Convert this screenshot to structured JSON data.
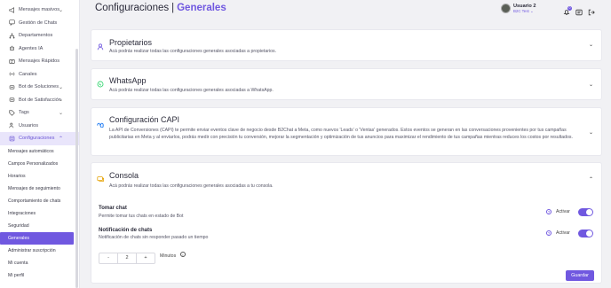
{
  "sidebar": {
    "items": [
      {
        "label": "Mensajes masivos",
        "icon": "megaphone-icon",
        "chevron": true
      },
      {
        "label": "Gestión de Chats",
        "icon": "chat-icon",
        "chevron": false
      },
      {
        "label": "Departamentos",
        "icon": "sitemap-icon",
        "chevron": false
      },
      {
        "label": "Agentes IA",
        "icon": "robot-icon",
        "chevron": false
      },
      {
        "label": "Mensajes Rápidos",
        "icon": "message-icon",
        "chevron": false
      },
      {
        "label": "Canales",
        "icon": "broadcast-icon",
        "chevron": false
      },
      {
        "label": "Bot de Soluciones",
        "icon": "bot-icon",
        "chevron": true
      },
      {
        "label": "Bot de Satisfacción",
        "icon": "bot-icon",
        "chevron": true
      },
      {
        "label": "Tags",
        "icon": "tag-icon",
        "chevron": true
      },
      {
        "label": "Usuarios",
        "icon": "users-icon",
        "chevron": false
      },
      {
        "label": "Configuraciones",
        "icon": "settings-icon",
        "chevron": true
      }
    ],
    "sub_items": [
      "Mensajes automáticos",
      "Campos Personalizados",
      "Horarios",
      "Mensajes de seguimiento",
      "Comportamiento de chats",
      "Integraciones",
      "Seguridad",
      "Generales",
      "Administrar suscripción",
      "Mi cuenta",
      "Mi perfil"
    ],
    "active_sub": "Generales"
  },
  "header": {
    "title": "Configuraciones",
    "separator": "|",
    "subtitle": "Generales",
    "user_name": "Usuario 2",
    "user_org": "B2C Test",
    "notif_count": "0"
  },
  "cards": {
    "propietarios": {
      "title": "Propietarios",
      "desc": "Acá podrás realizar todas las configuraciones generales asociadas a propietarios."
    },
    "whatsapp": {
      "title": "WhatsApp",
      "desc": "Acá podrás realizar todas las configuraciones generales asociadas a WhatsApp."
    },
    "capi": {
      "title": "Configuración CAPI",
      "desc": "La API de Conversiones (CAPI) te permite enviar eventos clave de negocio desde B2Chat a Meta, como nuevos 'Leads' o 'Ventas' generados. Estos eventos se generan en las conversaciones provenientes por tus campañas publicitarias en Meta y al enviarlos, podrás medir con precisión tu conversión, mejorar la segmentación y optimización de tus anuncios para maximizar el rendimiento de tus campañas mientras reduces los costos por resultados."
    },
    "consola": {
      "title": "Consola",
      "desc": "Acá podrás realizar todas las configuraciones generales asociadas a tu consola."
    }
  },
  "settings": {
    "take_chat": {
      "title": "Tomar chat",
      "desc": "Permite tomar tus chats en estado de Bot",
      "toggle_label": "Activar",
      "enabled": true
    },
    "notif": {
      "title": "Notificación de chats",
      "desc": "Notificación de chats sin responder pasado un tiempo",
      "toggle_label": "Activar",
      "enabled": true
    },
    "minutes_value": "2",
    "minus": "-",
    "plus": "+",
    "minutes_label": "Minutos",
    "save_label": "Guardar"
  },
  "colors": {
    "accent": "#7058e0",
    "whatsapp": "#25d366",
    "meta": "#1877f2",
    "consola": "#e6a100"
  }
}
